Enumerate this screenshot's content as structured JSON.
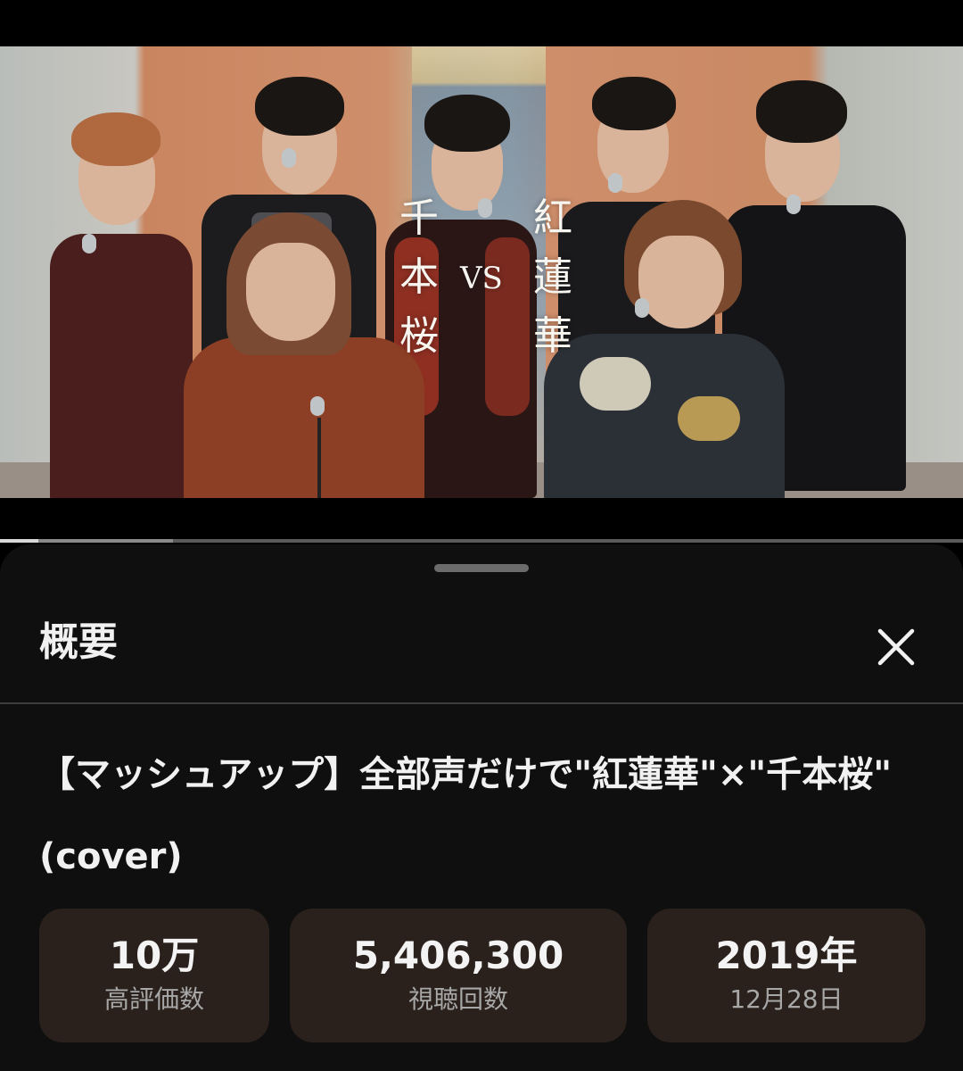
{
  "video": {
    "overlay_left": [
      "千",
      "本",
      "桜"
    ],
    "overlay_vs": "VS",
    "overlay_right": [
      "紅",
      "蓮",
      "華"
    ],
    "progress": {
      "played_fraction": 0.04,
      "buffered_fraction": 0.18
    }
  },
  "sheet": {
    "title": "概要",
    "close_icon": "close-icon",
    "video_title": "【マッシュアップ】全部声だけで\"紅蓮華\"×\"千本桜\" (cover)"
  },
  "stats": [
    {
      "value": "10万",
      "label": "高評価数"
    },
    {
      "value": "5,406,300",
      "label": "視聴回数"
    },
    {
      "value": "2019年",
      "label": "12月28日"
    }
  ],
  "colors": {
    "sheet_bg": "#0f0f0f",
    "stat_bg": "#2a211c",
    "label_gray": "#a7a7a7"
  }
}
